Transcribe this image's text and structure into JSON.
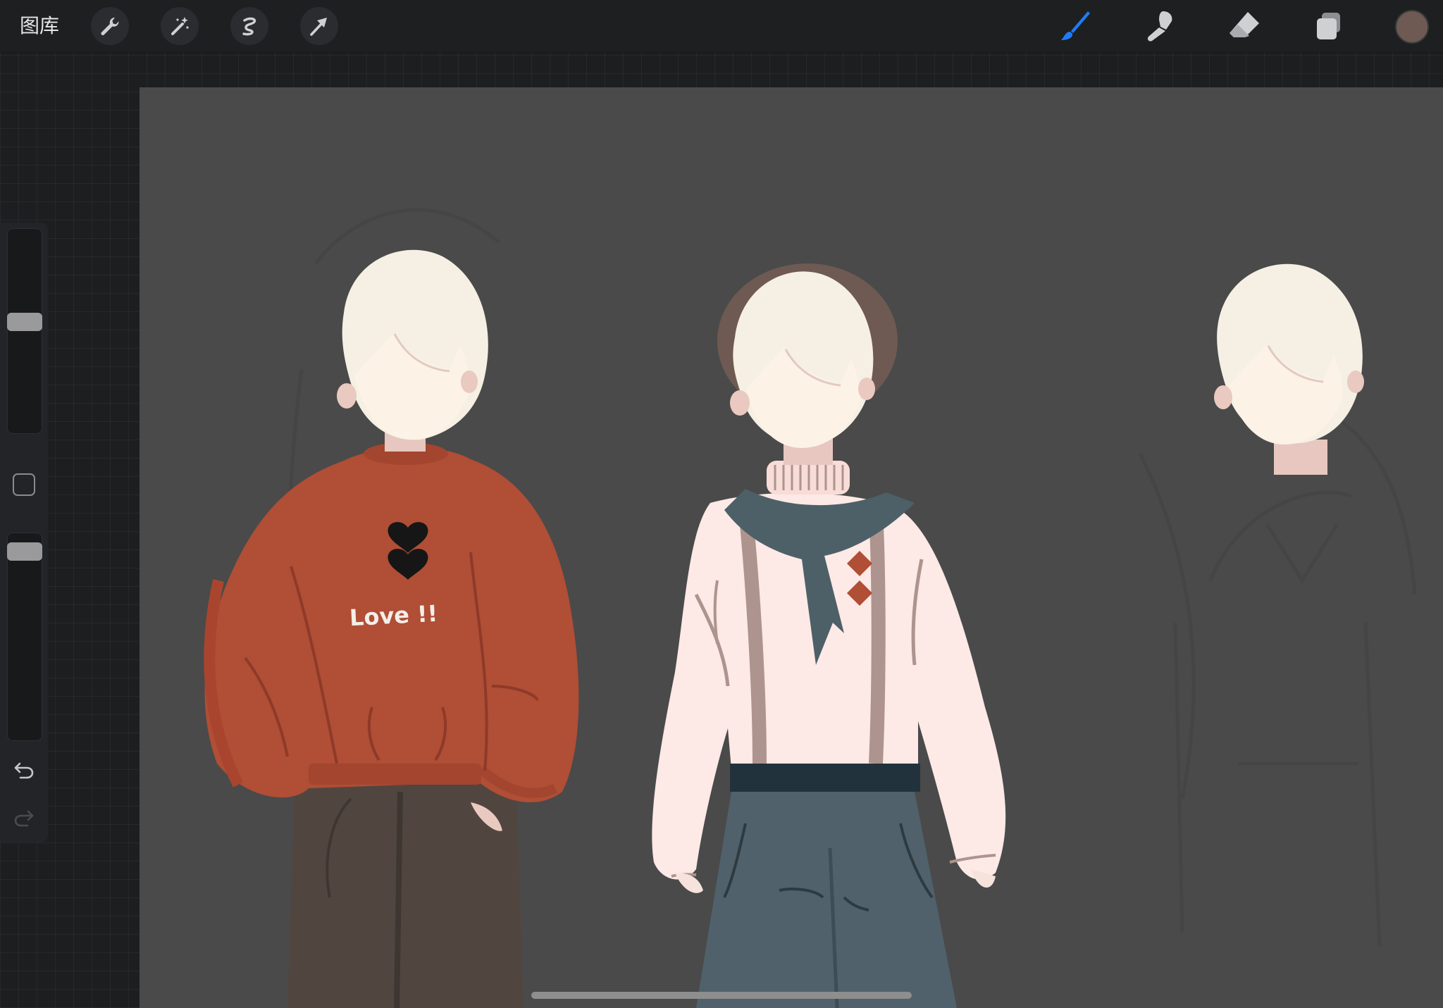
{
  "topbar": {
    "gallery_label": "图库",
    "left_tools": [
      "wrench-icon",
      "magic-wand-icon",
      "selection-icon",
      "transform-arrow-icon"
    ],
    "right_tools": [
      "brush-icon",
      "smudge-icon",
      "eraser-icon",
      "layers-icon"
    ],
    "active_tool": "brush-icon",
    "accent_color": "#1e7df5",
    "current_color": "#6e5a52"
  },
  "sidebar": {
    "brush_size_level": 0.45,
    "opacity_level": 0.05
  },
  "canvas": {
    "background_color": "#4a4a4a",
    "artwork_text": "Love !!"
  }
}
